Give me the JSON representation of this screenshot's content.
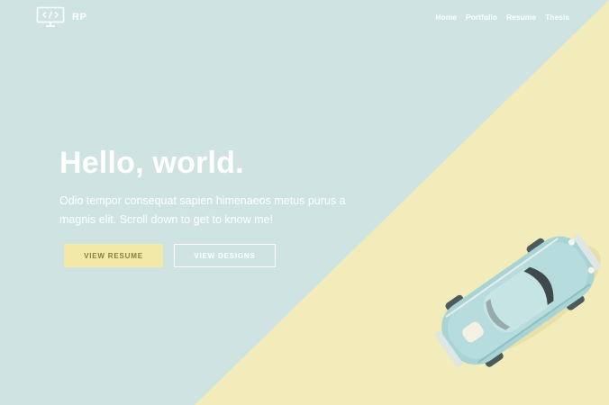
{
  "header": {
    "logo_text": "RP",
    "logo_icon": "code-monitor-icon",
    "nav": [
      {
        "label": "Home"
      },
      {
        "label": "Portfolio"
      },
      {
        "label": "Resume"
      },
      {
        "label": "Thesis"
      }
    ]
  },
  "hero": {
    "title": "Hello, world.",
    "subtitle": "Odio tempor consequat sapien himenaeos metus purus a magnis elit. Scroll down to get to know me!",
    "primary_button": "VIEW RESUME",
    "secondary_button": "VIEW DESIGNS"
  },
  "colors": {
    "background_blue": "#cfe4e2",
    "background_yellow": "#f1ecb9",
    "primary_button_bg": "#f2e9a8",
    "primary_button_text": "#8a7c3a",
    "text_light": "#ffffff",
    "car_body": "#a9d4d6"
  },
  "illustration": {
    "name": "toy-car-image"
  }
}
